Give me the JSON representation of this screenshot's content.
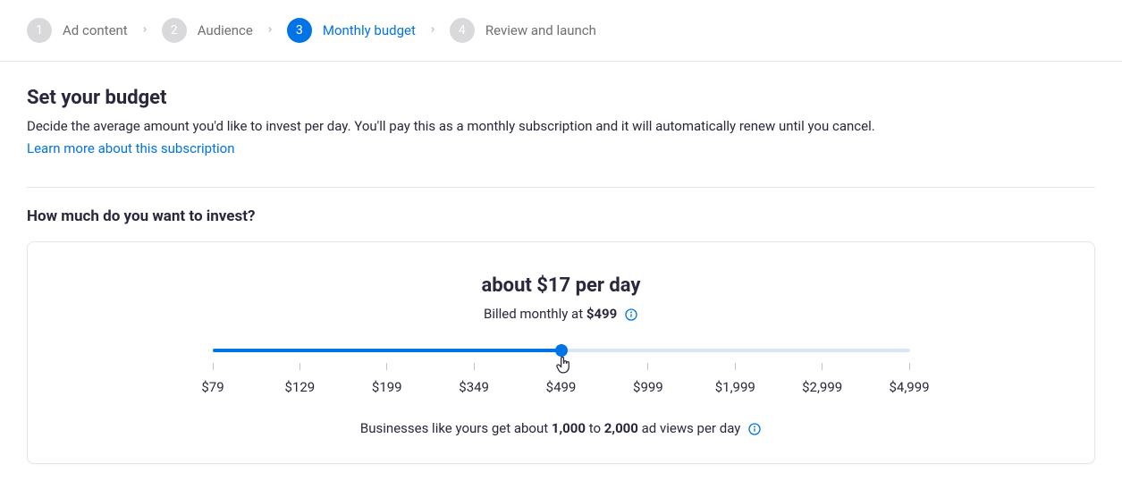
{
  "stepper": {
    "steps": [
      {
        "num": "1",
        "label": "Ad content",
        "active": false
      },
      {
        "num": "2",
        "label": "Audience",
        "active": false
      },
      {
        "num": "3",
        "label": "Monthly budget",
        "active": true
      },
      {
        "num": "4",
        "label": "Review and launch",
        "active": false
      }
    ]
  },
  "budget": {
    "heading": "Set your budget",
    "subtext": "Decide the average amount you'd like to invest per day. You'll pay this as a monthly subscription and it will automatically renew until you cancel.",
    "learn_more": "Learn more about this subscription",
    "question": "How much do you want to invest?",
    "per_day": "about $17 per day",
    "billed_prefix": "Billed monthly at ",
    "billed_amount": "$499",
    "slider": {
      "fill_percent": 50,
      "thumb_percent": 50,
      "ticks": [
        "$79",
        "$129",
        "$199",
        "$349",
        "$499",
        "$999",
        "$1,999",
        "$2,999",
        "$4,999"
      ]
    },
    "footnote": {
      "prefix": "Businesses like yours get about ",
      "low": "1,000",
      "to": " to ",
      "high": "2,000",
      "suffix": " ad views per day"
    }
  }
}
